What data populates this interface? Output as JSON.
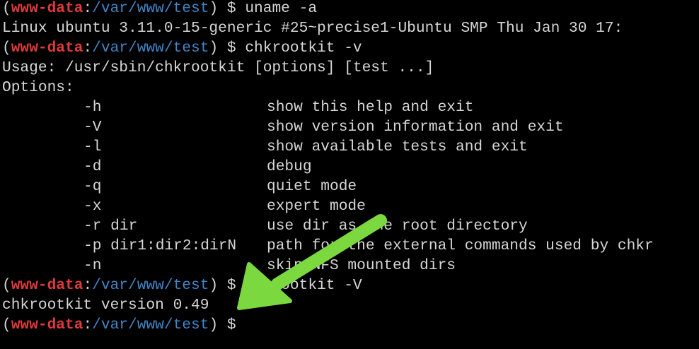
{
  "prompt": {
    "open": "(",
    "user": "www-data",
    "colon": ":",
    "cwd": "/var/www/test",
    "close": ")",
    "dollar": "$"
  },
  "lines": {
    "cmd1": "uname -a",
    "uname_output": "Linux ubuntu 3.11.0-15-generic #25~precise1-Ubuntu SMP Thu Jan 30 17:",
    "cmd2": "chkrootkit -v",
    "usage": "Usage: /usr/sbin/chkrootkit [options] [test ...]",
    "options_header": "Options:",
    "options": [
      {
        "flag": "-h",
        "desc": "show this help and exit"
      },
      {
        "flag": "-V",
        "desc": "show version information and exit"
      },
      {
        "flag": "-l",
        "desc": "show available tests and exit"
      },
      {
        "flag": "-d",
        "desc": "debug"
      },
      {
        "flag": "-q",
        "desc": "quiet mode"
      },
      {
        "flag": "-x",
        "desc": "expert mode"
      },
      {
        "flag": "-r dir",
        "desc": "use dir as the root directory"
      },
      {
        "flag": "-p dir1:dir2:dirN",
        "desc": "path for the external commands used by chkr"
      },
      {
        "flag": "-n",
        "desc": "skip NFS mounted dirs"
      }
    ],
    "cmd3": "chkrootkit -V",
    "version_output": "chkrootkit version 0.49"
  },
  "colors": {
    "background": "#000000",
    "user": "#e23a3a",
    "path": "#3f86c7",
    "text": "#d6d6d6",
    "arrow": "#7bd93f"
  },
  "annotation": {
    "icon": "arrow-icon"
  }
}
